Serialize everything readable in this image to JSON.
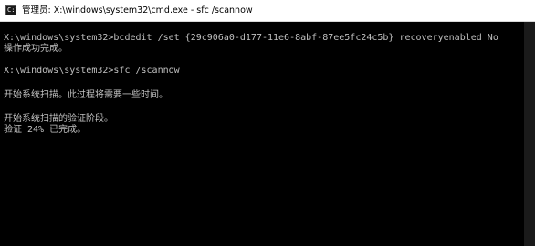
{
  "window": {
    "title": "管理员: X:\\windows\\system32\\cmd.exe - sfc  /scannow",
    "icon": "cmd-icon",
    "icon_glyph": "C:\\"
  },
  "console": {
    "lines": [
      "X:\\windows\\system32>bcdedit /set {29c906a0-d177-11e6-8abf-87ee5fc24c5b} recoveryenabled No",
      "操作成功完成。",
      "X:\\windows\\system32>sfc /scannow",
      "开始系统扫描。此过程将需要一些时间。",
      "开始系统扫描的验证阶段。",
      "验证 24% 已完成。"
    ]
  },
  "colors": {
    "console_background": "#000000",
    "console_text": "#c0c0c0",
    "titlebar_background": "#ffffff"
  }
}
